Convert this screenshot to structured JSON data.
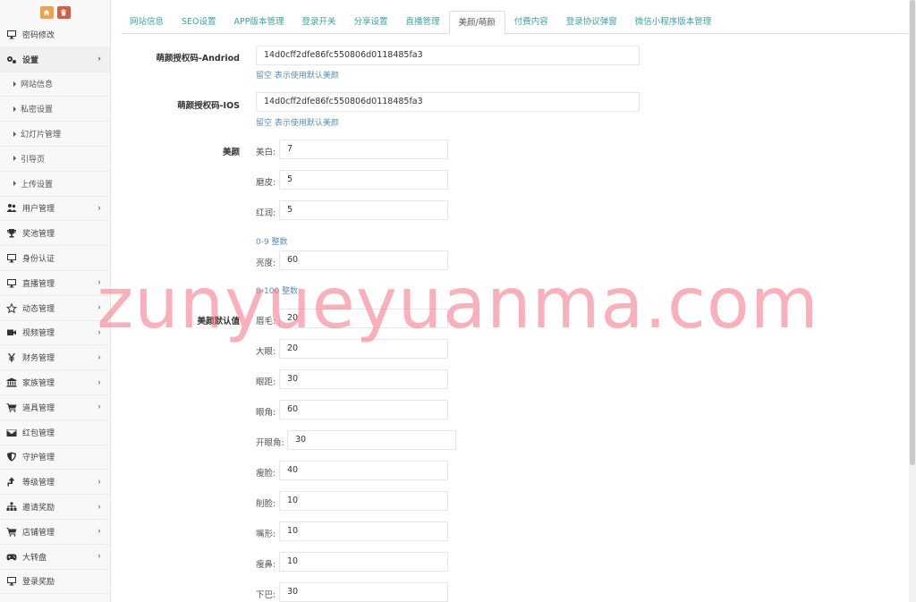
{
  "sidebar": {
    "top_buttons": [
      {
        "icon": "home-icon"
      },
      {
        "icon": "trash-icon"
      }
    ],
    "items": [
      {
        "label": "密码修改",
        "icon": "monitor-icon",
        "chevron": false
      },
      {
        "label": "设置",
        "icon": "gears-icon",
        "chevron": true,
        "active": true
      },
      {
        "label": "用户管理",
        "icon": "users-icon",
        "chevron": true
      },
      {
        "label": "奖池管理",
        "icon": "trophy-icon",
        "chevron": false
      },
      {
        "label": "身份认证",
        "icon": "monitor-icon",
        "chevron": false
      },
      {
        "label": "直播管理",
        "icon": "monitor-icon",
        "chevron": true
      },
      {
        "label": "动态管理",
        "icon": "star-icon",
        "chevron": true
      },
      {
        "label": "视频管理",
        "icon": "video-icon",
        "chevron": true
      },
      {
        "label": "财务管理",
        "icon": "yen-icon",
        "chevron": true
      },
      {
        "label": "家族管理",
        "icon": "bank-icon",
        "chevron": true
      },
      {
        "label": "道具管理",
        "icon": "cart-icon",
        "chevron": true
      },
      {
        "label": "红包管理",
        "icon": "envelope-icon",
        "chevron": false
      },
      {
        "label": "守护管理",
        "icon": "shield-icon",
        "chevron": false
      },
      {
        "label": "等级管理",
        "icon": "level-icon",
        "chevron": true
      },
      {
        "label": "邀请奖励",
        "icon": "sitemap-icon",
        "chevron": true
      },
      {
        "label": "店铺管理",
        "icon": "cart-icon",
        "chevron": true
      },
      {
        "label": "大转盘",
        "icon": "gamepad-icon",
        "chevron": true
      },
      {
        "label": "登录奖励",
        "icon": "monitor-icon",
        "chevron": false
      }
    ],
    "sub_items": [
      "网站信息",
      "私密设置",
      "幻灯片管理",
      "引导页",
      "上传设置"
    ]
  },
  "tabs": [
    {
      "label": "网站信息"
    },
    {
      "label": "SEO设置"
    },
    {
      "label": "APP版本管理"
    },
    {
      "label": "登录开关"
    },
    {
      "label": "分享设置"
    },
    {
      "label": "直播管理"
    },
    {
      "label": "美颜/萌颜",
      "active": true
    },
    {
      "label": "付费内容"
    },
    {
      "label": "登录协议弹窗"
    },
    {
      "label": "微信小程序版本管理"
    }
  ],
  "form": {
    "android_label": "萌颜授权码-Andriod",
    "android_value": "14d0cff2dfe86fc550806d0118485fa3",
    "android_hint": "留空 表示使用默认美颜",
    "ios_label": "萌颜授权码-IOS",
    "ios_value": "14d0cff2dfe86fc550806d0118485fa3",
    "ios_hint": "留空 表示使用默认美颜",
    "beauty_label": "美颜",
    "whiten_label": "美白:",
    "whiten_value": "7",
    "smooth_label": "磨皮:",
    "smooth_value": "5",
    "ruddy_label": "红润:",
    "ruddy_value": "5",
    "range_hint_1": "0-9 整数",
    "brightness_label": "亮度:",
    "brightness_value": "60",
    "range_hint_2": "0-100 整数",
    "default_label": "美颜默认值",
    "brow_label": "眉毛:",
    "brow_value": "20",
    "bigeye_label": "大眼:",
    "bigeye_value": "20",
    "eyedist_label": "眼距:",
    "eyedist_value": "30",
    "eyeangle_label": "眼角:",
    "eyeangle_value": "60",
    "eyeopen_label": "开眼角:",
    "eyeopen_value": "30",
    "thinface_label": "瘦脸:",
    "thinface_value": "40",
    "cutface_label": "削脸:",
    "cutface_value": "10",
    "mouth_label": "嘴形:",
    "mouth_value": "10",
    "thinnose_label": "瘦鼻:",
    "thinnose_value": "10",
    "chin_label": "下巴:",
    "chin_value": "30"
  },
  "watermark": "zunyueyuanma.com"
}
